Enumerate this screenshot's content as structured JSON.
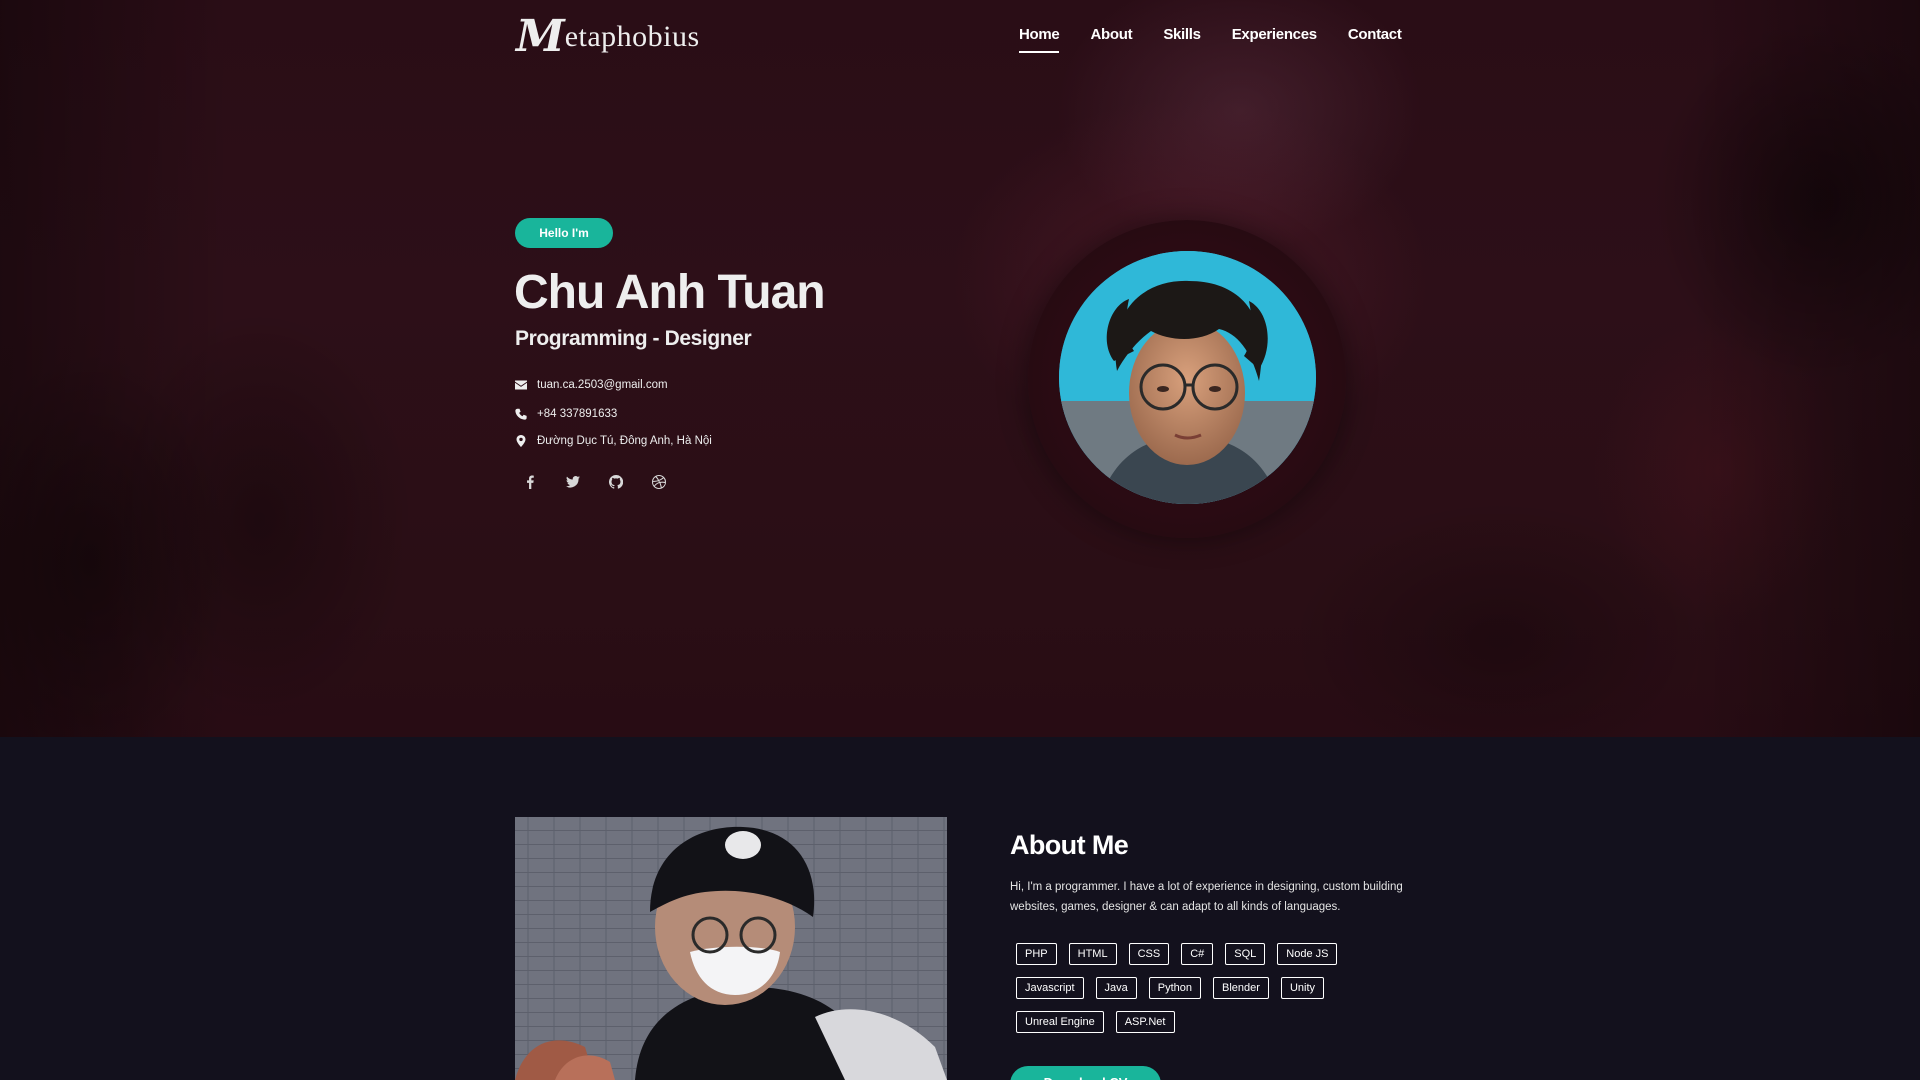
{
  "brand": {
    "logo_mark": "M",
    "logo_text": "etaphobius"
  },
  "nav": {
    "items": [
      {
        "label": "Home",
        "active": true
      },
      {
        "label": "About"
      },
      {
        "label": "Skills"
      },
      {
        "label": "Experiences"
      },
      {
        "label": "Contact"
      }
    ]
  },
  "hero": {
    "badge": "Hello I'm",
    "name": "Chu Anh Tuan",
    "role": "Programming - Designer",
    "email": "tuan.ca.2503@gmail.com",
    "phone": "+84 337891633",
    "address": "Đường Dục Tú, Đông Anh, Hà Nội",
    "socials": [
      "facebook-icon",
      "twitter-icon",
      "github-icon",
      "dribbble-icon"
    ]
  },
  "about": {
    "title": "About Me",
    "text": "Hi, I'm a programmer. I have a lot of experience in designing, custom building websites, games, designer & can adapt to all kinds of languages.",
    "tags_row1": [
      "PHP",
      "HTML",
      "CSS",
      "C#",
      "SQL",
      "Node JS"
    ],
    "tags_row2": [
      "Javascript",
      "Java",
      "Python",
      "Blender",
      "Unity"
    ],
    "tags_row3": [
      "Unreal Engine",
      "ASP.Net"
    ],
    "cv_button": "Download CV"
  },
  "colors": {
    "accent": "#19b59b",
    "hero_bg": "#2a0d16",
    "page_bg": "#13111d"
  }
}
